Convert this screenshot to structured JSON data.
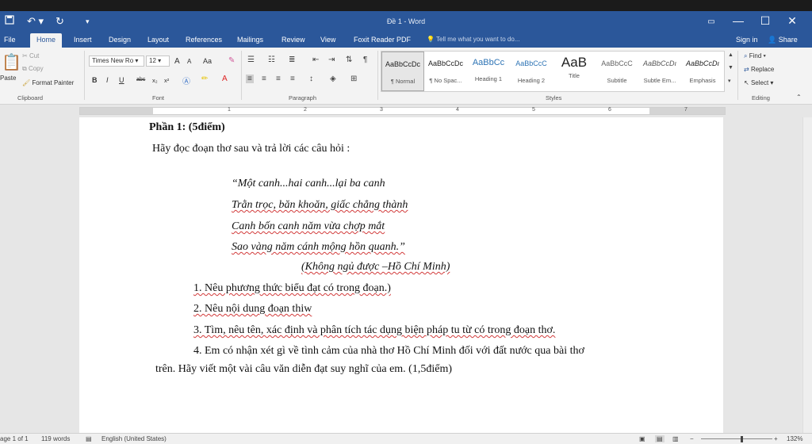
{
  "window": {
    "title": "Đề 1 - Word",
    "controls": {
      "restore": "▭",
      "minimize": "—",
      "maximize": "☐",
      "close": "✕"
    }
  },
  "quick_access": {
    "save_icon": "floppy-icon",
    "undo": "↶ ▾",
    "redo": "↻",
    "customize": "▾"
  },
  "tabs": [
    "File",
    "Home",
    "Insert",
    "Design",
    "Layout",
    "References",
    "Mailings",
    "Review",
    "View",
    "Foxit Reader PDF"
  ],
  "active_tab": "Home",
  "tell_me": "Tell me what you want to do...",
  "account": {
    "sign_in": "Sign in",
    "share": "Share"
  },
  "ribbon": {
    "clipboard": {
      "paste": "Paste",
      "cut": "Cut",
      "copy": "Copy",
      "format_painter": "Format Painter",
      "label": "Clipboard"
    },
    "font": {
      "family": "Times New Ro",
      "size": "12",
      "grow": "A",
      "shrink": "A",
      "case": "Aa",
      "bold": "B",
      "italic": "I",
      "underline": "U",
      "strike": "abc",
      "subscript": "x₂",
      "superscript": "x²",
      "label": "Font"
    },
    "paragraph": {
      "label": "Paragraph",
      "show_marks": "¶"
    },
    "styles": {
      "label": "Styles",
      "items": [
        {
          "preview": "AaBbCcDc",
          "name": "¶ Normal"
        },
        {
          "preview": "AaBbCcDc",
          "name": "¶ No Spac..."
        },
        {
          "preview": "AaBbCc",
          "name": "Heading 1"
        },
        {
          "preview": "AaBbCcC",
          "name": "Heading 2"
        },
        {
          "preview": "AaB",
          "name": "Title"
        },
        {
          "preview": "AaBbCcC",
          "name": "Subtitle"
        },
        {
          "preview": "AaBbCcDı",
          "name": "Subtle Em..."
        },
        {
          "preview": "AaBbCcDı",
          "name": "Emphasis"
        }
      ]
    },
    "editing": {
      "find": "Find",
      "replace": "Replace",
      "select": "Select",
      "label": "Editing"
    }
  },
  "ruler": {
    "numbers": [
      "1",
      "2",
      "3",
      "4",
      "5",
      "6",
      "7"
    ]
  },
  "document": {
    "heading": "Phần 1: (5điểm)",
    "instruction": "Hãy đọc đoạn thơ sau và trả lời các câu hỏi :",
    "poem": [
      "“Một canh...hai canh...lại ba canh",
      "Trằn trọc, băn khoăn, giấc chẳng thành",
      "Canh bốn canh năm vừa chợp mắt",
      "Sao vàng năm cánh mộng hồn quanh.”"
    ],
    "source": "(Không ngủ được –Hồ Chí Minh)",
    "questions": [
      "1. Nêu phương thức biểu đạt có trong đoạn.)",
      "2. Nêu nội dung đoạn thiw",
      "3. Tìm, nêu tên, xác định và phân tích tác dụng biện pháp tu từ có trong đoạn thơ.",
      "4. Em có nhận xét gì về tình cảm của nhà thơ Hồ Chí Minh đối với đất nước qua bài thơ"
    ],
    "question4_cont": "trên. Hãy viết một vài câu văn diễn đạt suy nghĩ  của em. (1,5điểm)"
  },
  "status": {
    "page": "age 1 of 1",
    "words": "119 words",
    "language": "English (United States)",
    "zoom": "132%"
  }
}
